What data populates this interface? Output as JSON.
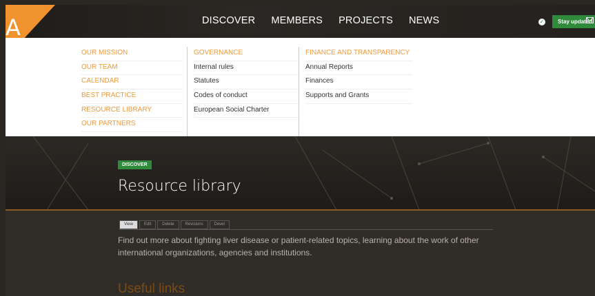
{
  "logo": {
    "letter": "A",
    "brand_color": "#f0922e"
  },
  "nav": {
    "items": [
      "DISCOVER",
      "MEMBERS",
      "PROJECTS",
      "NEWS"
    ]
  },
  "stay_updated": {
    "label": "Stay updated",
    "icon": "envelope-icon",
    "check_icon": "check-icon",
    "color": "#2f8a3c"
  },
  "dropdown": {
    "col1": [
      "OUR MISSION",
      "OUR TEAM",
      "CALENDAR",
      "BEST PRACTICE",
      "RESOURCE LIBRARY",
      "OUR PARTNERS"
    ],
    "col2": {
      "heading": "GOVERNANCE",
      "links": [
        "Internal rules",
        "Statutes",
        "Codes of conduct",
        "European Social Charter"
      ]
    },
    "col3": {
      "heading": "FINANCE AND TRANSPARENCY",
      "links": [
        "Annual Reports",
        "Finances",
        "Supports and Grants"
      ]
    }
  },
  "hero": {
    "badge": "DISCOVER",
    "title": "Resource library"
  },
  "tabs": [
    "View",
    "Edit",
    "Delete",
    "Revisions",
    "Devel"
  ],
  "content": {
    "intro": "Find out more about fighting liver disease or patient-related topics, learning about the work of other international organizations, agencies and institutions.",
    "heading": "Useful links"
  }
}
